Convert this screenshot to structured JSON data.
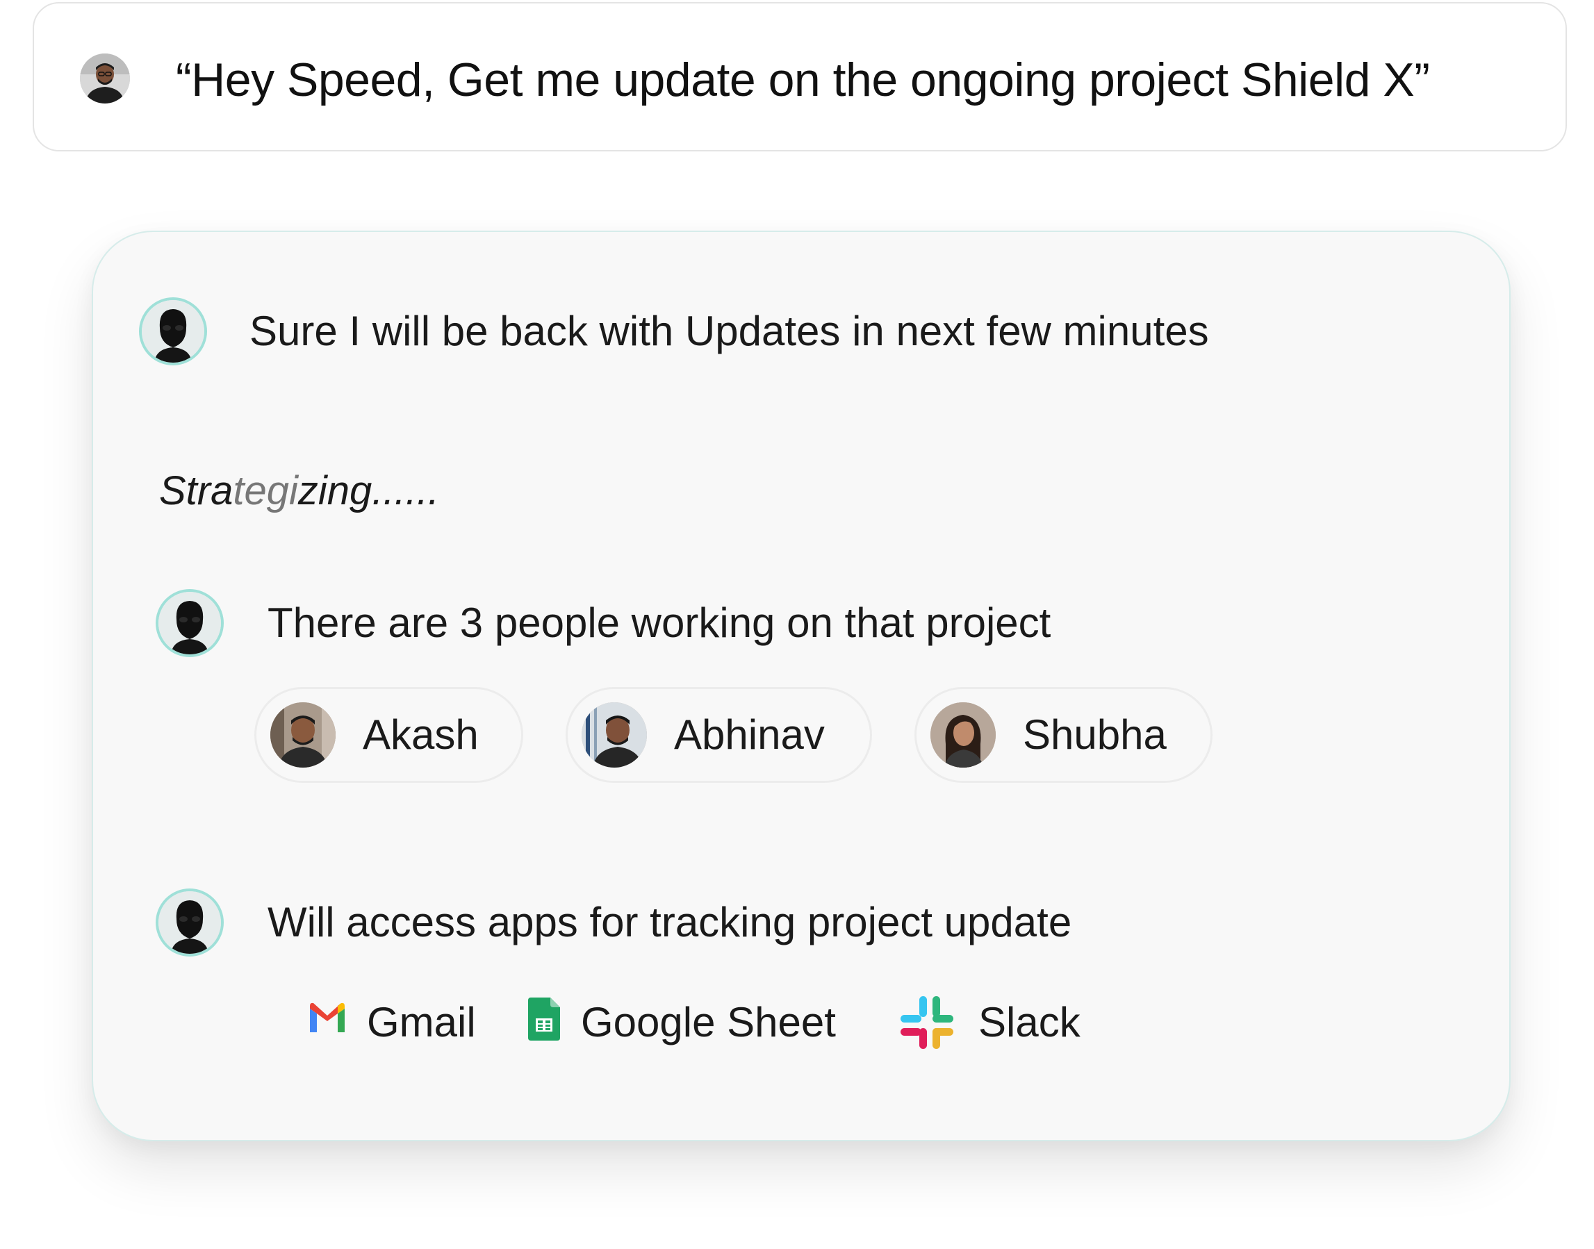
{
  "prompt": {
    "text": "“Hey Speed, Get me update on the ongoing project Shield X”",
    "avatar_icon": "user-avatar"
  },
  "agent": {
    "avatar_icon": "masked-bot-avatar",
    "accent_color": "#9fe0d8",
    "messages": {
      "ack": "Sure I will be back with Updates in next few minutes",
      "people_intro": "There are 3 people working on that project",
      "apps_intro": "Will access apps for tracking project update"
    },
    "status": {
      "part_a": "Stra",
      "part_b": "tegi",
      "part_c": "zing......"
    },
    "people": [
      {
        "name": "Akash"
      },
      {
        "name": "Abhinav"
      },
      {
        "name": "Shubha"
      }
    ],
    "apps": [
      {
        "name": "Gmail",
        "icon": "gmail-icon"
      },
      {
        "name": "Google Sheet",
        "icon": "google-sheets-icon"
      },
      {
        "name": "Slack",
        "icon": "slack-icon"
      }
    ]
  }
}
